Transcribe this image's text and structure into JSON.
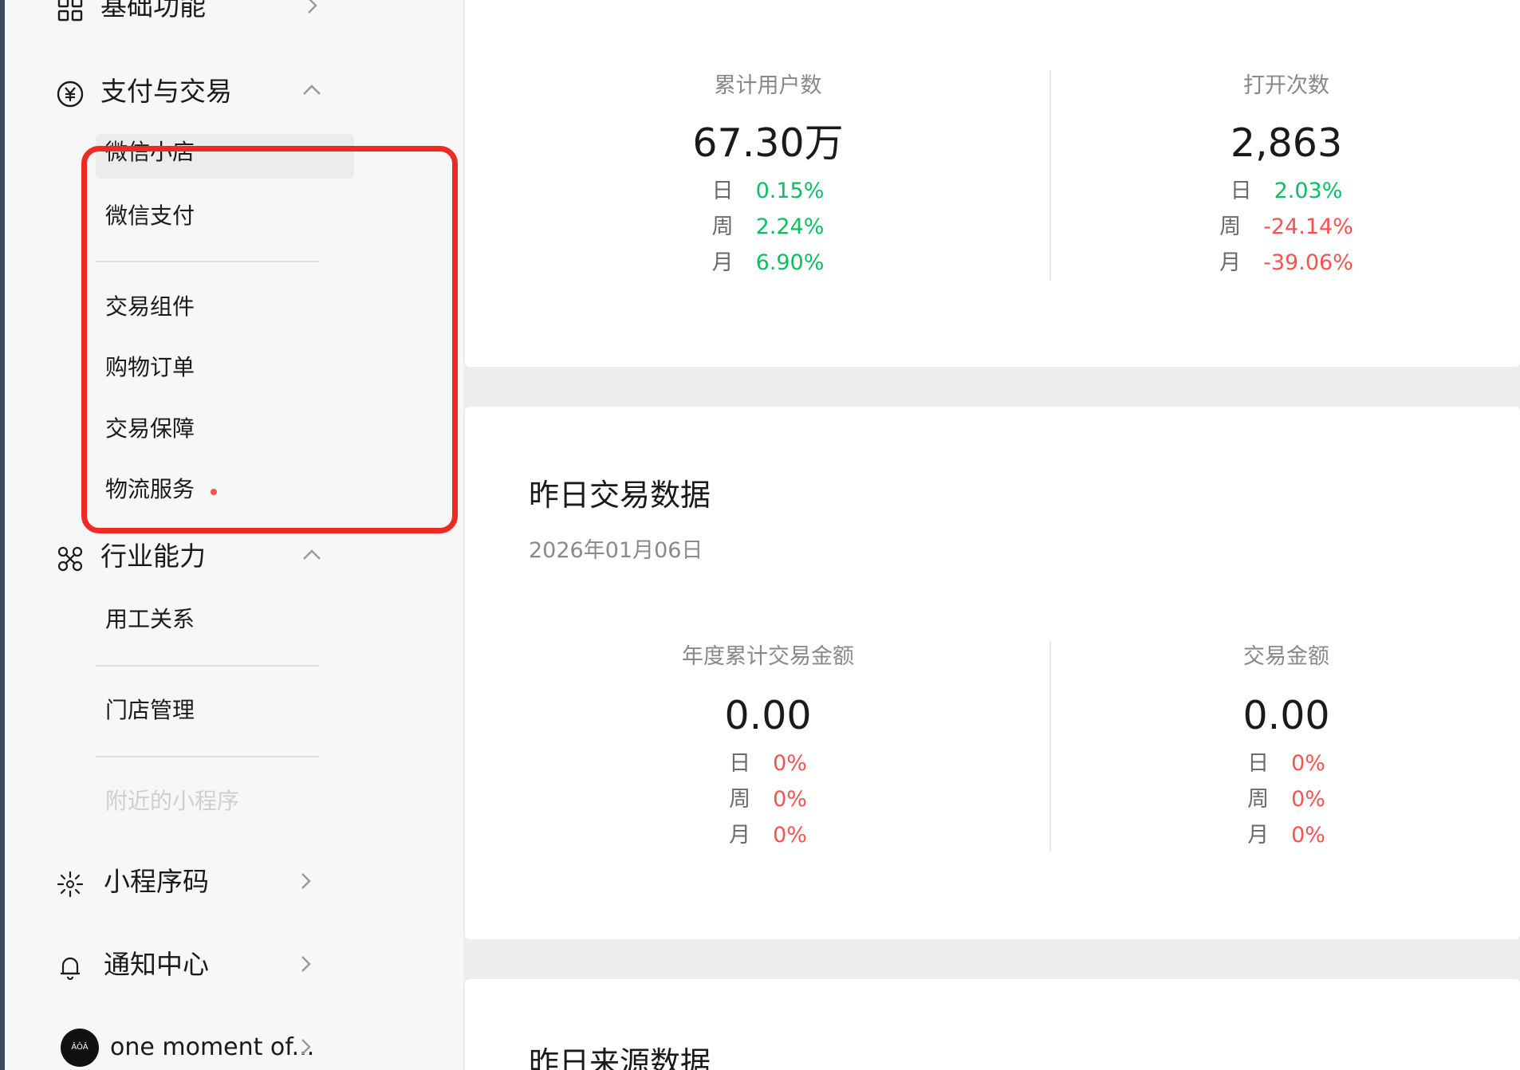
{
  "sidebar": {
    "basic": {
      "label": "基础功能",
      "icon": "grid-icon"
    },
    "payment": {
      "label": "支付与交易",
      "icon": "yuan-icon",
      "items": [
        "微信小店",
        "微信支付",
        "交易组件",
        "购物订单",
        "交易保障",
        "物流服务"
      ]
    },
    "industry": {
      "label": "行业能力",
      "icon": "nodes-icon",
      "items": [
        "用工关系",
        "门店管理",
        "附近的小程序"
      ]
    },
    "qrcode": {
      "label": "小程序码",
      "icon": "sparkle-code-icon"
    },
    "notify": {
      "label": "通知中心",
      "icon": "bell-icon"
    },
    "account": {
      "name": "one moment of...",
      "avatar_text": "ÂÔÂ"
    }
  },
  "users_card": {
    "left": {
      "label": "累计用户数",
      "value": "67.30万",
      "rows": [
        {
          "period": "日",
          "change": "0.15%"
        },
        {
          "period": "周",
          "change": "2.24%"
        },
        {
          "period": "月",
          "change": "6.90%"
        }
      ]
    },
    "right": {
      "label": "打开次数",
      "value": "2,863",
      "rows": [
        {
          "period": "日",
          "change": "2.03%"
        },
        {
          "period": "周",
          "change": "-24.14%"
        },
        {
          "period": "月",
          "change": "-39.06%"
        }
      ]
    }
  },
  "trade_card": {
    "title": "昨日交易数据",
    "date": "2026年01月06日",
    "left": {
      "label": "年度累计交易金额",
      "value": "0.00",
      "rows": [
        {
          "period": "日",
          "change": "0%"
        },
        {
          "period": "周",
          "change": "0%"
        },
        {
          "period": "月",
          "change": "0%"
        }
      ]
    },
    "right": {
      "label": "交易金额",
      "value": "0.00",
      "rows": [
        {
          "period": "日",
          "change": "0%"
        },
        {
          "period": "周",
          "change": "0%"
        },
        {
          "period": "月",
          "change": "0%"
        }
      ]
    }
  },
  "source_card": {
    "title": "昨日来源数据"
  },
  "colors": {
    "up": "#07c160",
    "down": "#fa5151",
    "highlight": "#ee2a24"
  }
}
